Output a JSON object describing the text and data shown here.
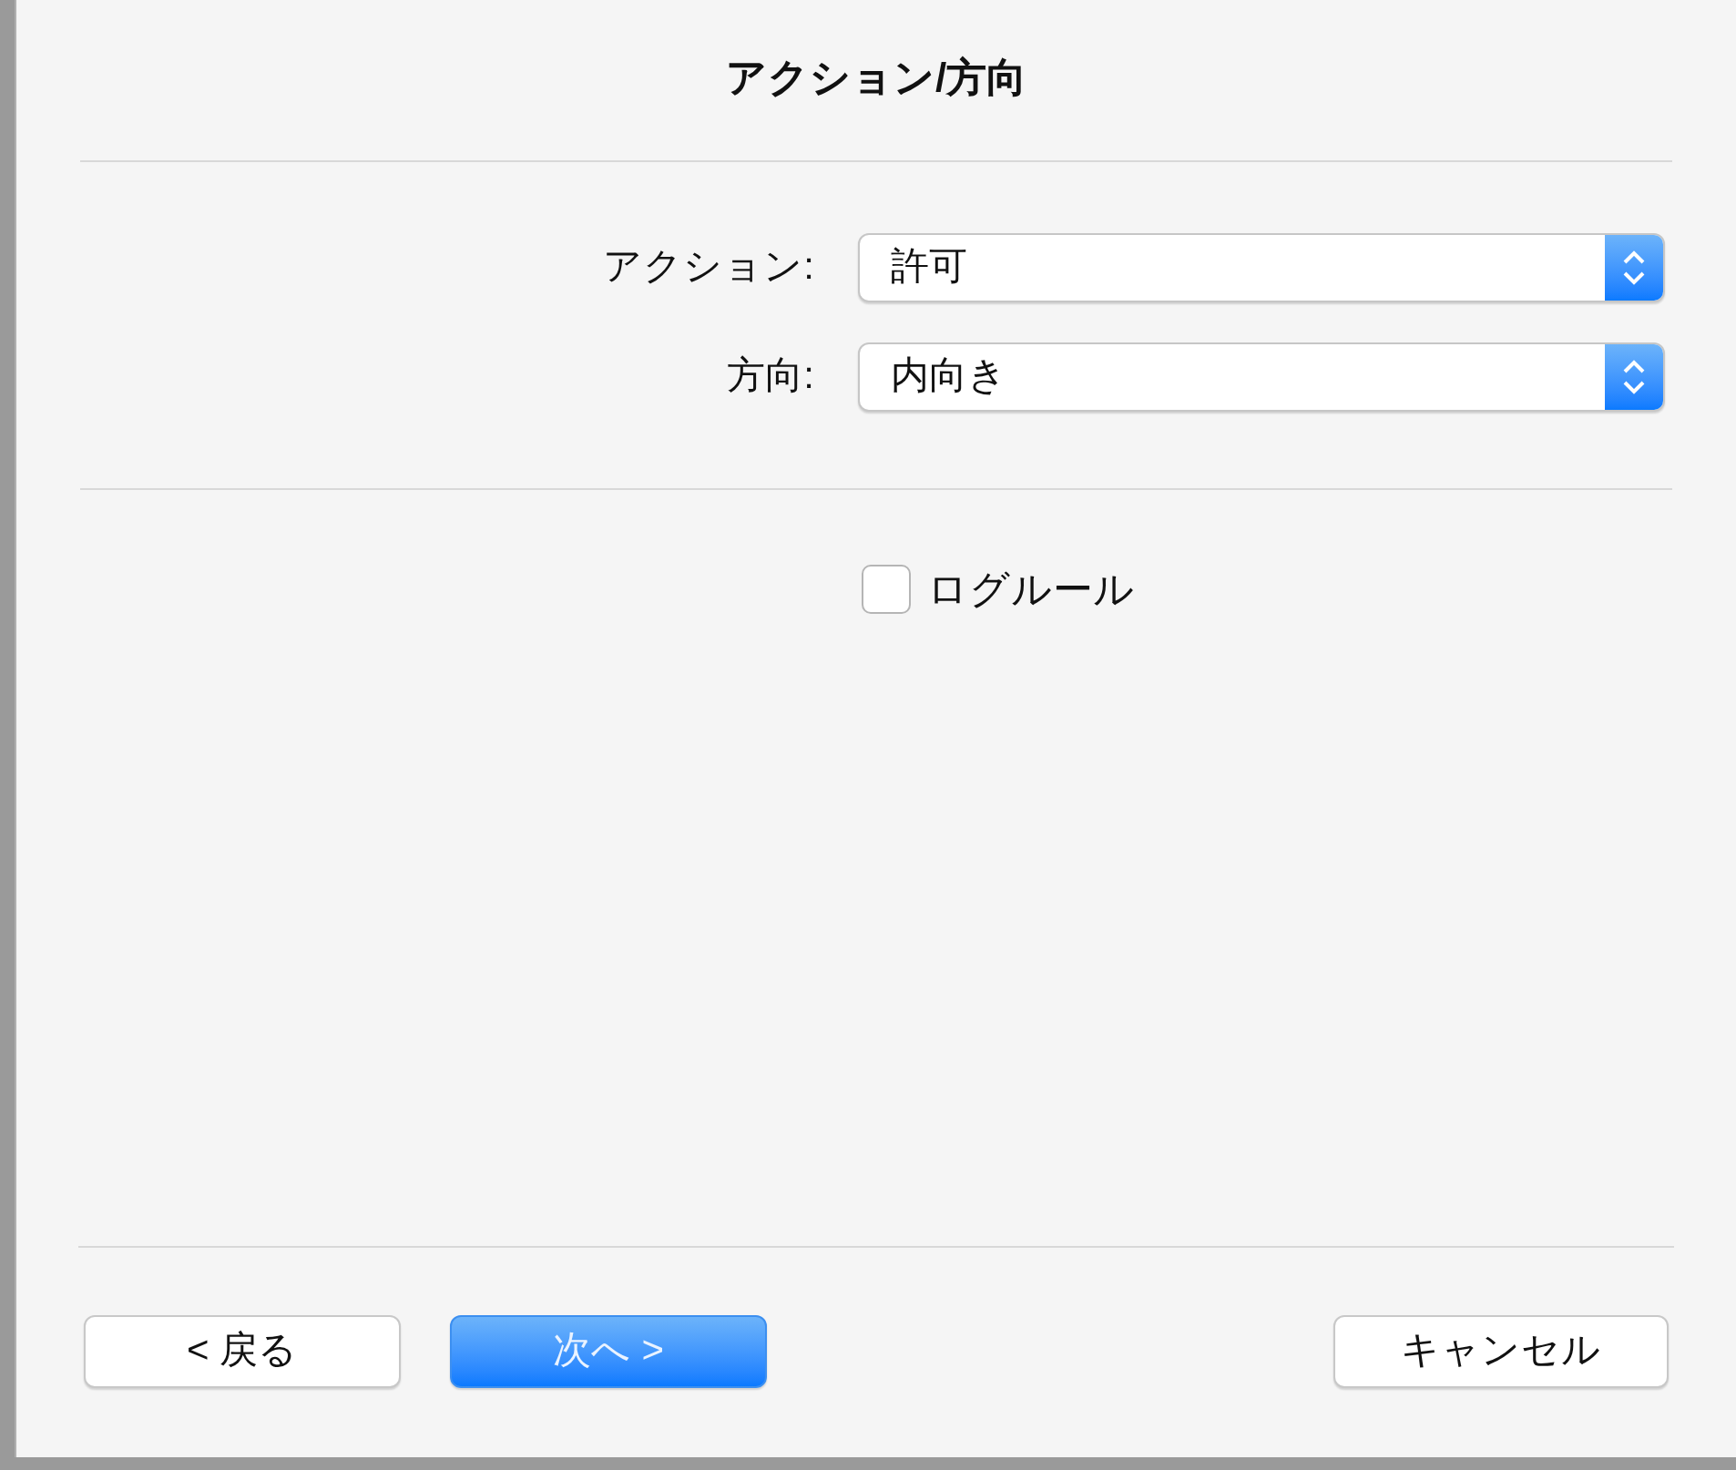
{
  "dialog": {
    "title": "アクション/方向"
  },
  "fields": [
    {
      "label": "アクション:",
      "value": "許可"
    },
    {
      "label": "方向:",
      "value": "内向き"
    }
  ],
  "log_rule": {
    "label": "ログルール",
    "checked": false
  },
  "nav_buttons": [
    {
      "label": "< 戻る",
      "kind": "normal"
    },
    {
      "label": "次へ >",
      "kind": "default"
    }
  ],
  "cancel_button": {
    "label": "キャンセル",
    "kind": "normal"
  }
}
